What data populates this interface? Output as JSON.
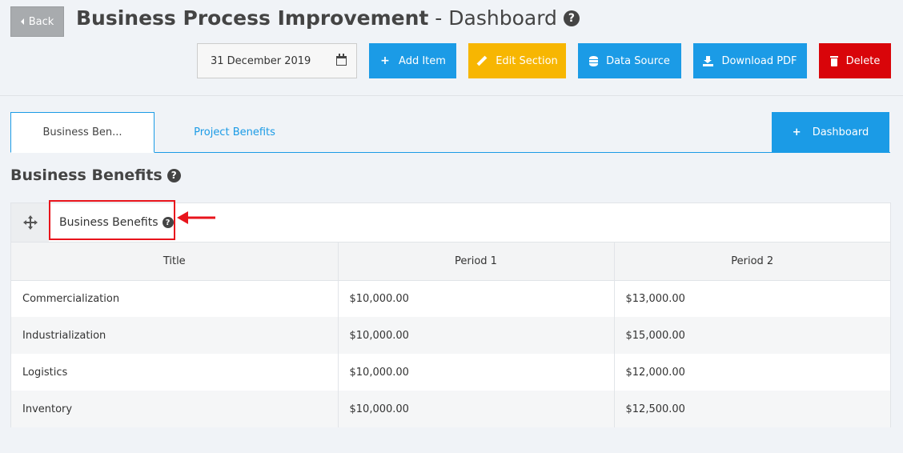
{
  "header": {
    "back_label": "Back",
    "title_bold": "Business Process Improvement",
    "title_separator": " - ",
    "title_suffix": "Dashboard",
    "help_glyph": "?"
  },
  "toolbar": {
    "date_value": "31 December 2019",
    "add_item_label": "Add Item",
    "edit_section_label": "Edit Section",
    "data_source_label": "Data Source",
    "download_pdf_label": "Download PDF",
    "delete_label": "Delete"
  },
  "tabs": [
    {
      "label": "Business Ben...",
      "active": true
    },
    {
      "label": "Project Benefits",
      "active": false
    }
  ],
  "dashboard_button_label": "Dashboard",
  "section": {
    "title": "Business Benefits"
  },
  "widget": {
    "title": "Business Benefits",
    "columns": [
      "Title",
      "Period 1",
      "Period 2"
    ],
    "rows": [
      [
        "Commercialization",
        "$10,000.00",
        "$13,000.00"
      ],
      [
        "Industrialization",
        "$10,000.00",
        "$15,000.00"
      ],
      [
        "Logistics",
        "$10,000.00",
        "$12,000.00"
      ],
      [
        "Inventory",
        "$10,000.00",
        "$12,500.00"
      ]
    ]
  },
  "colors": {
    "primary": "#1b9be6",
    "warning": "#f7b602",
    "danger": "#d9050a",
    "annotation": "#e8141c",
    "background": "#f0f3f7"
  },
  "icons": {
    "back": "caret-left-icon",
    "help": "question-circle-icon",
    "calendar": "calendar-icon",
    "add": "plus-icon",
    "edit": "pencil-icon",
    "data_source": "database-icon",
    "download": "download-icon",
    "delete": "trash-icon",
    "move": "move-arrows-icon"
  }
}
